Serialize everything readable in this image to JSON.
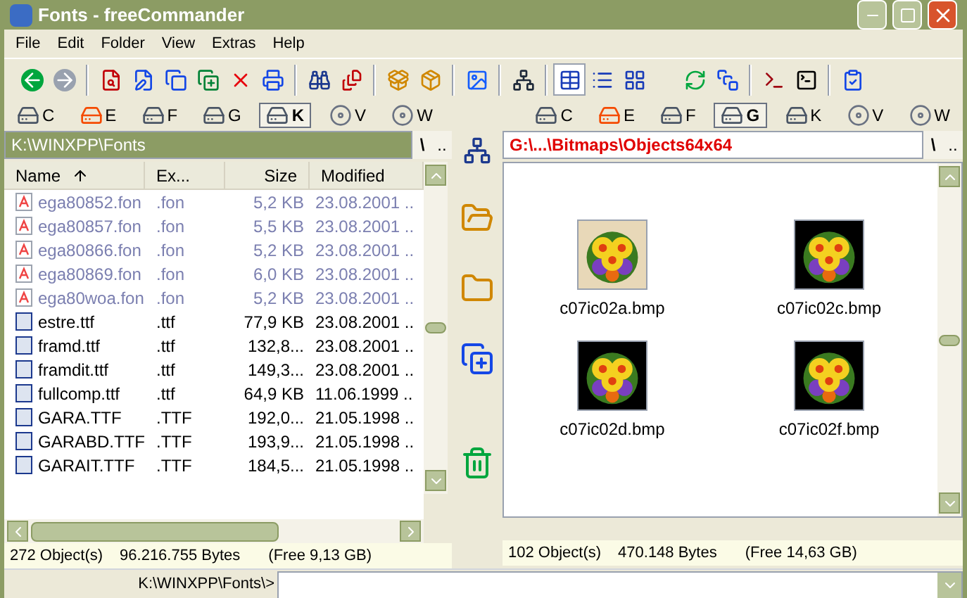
{
  "window": {
    "title": "Fonts - freeCommander"
  },
  "menu": [
    "File",
    "Edit",
    "Folder",
    "View",
    "Extras",
    "Help"
  ],
  "view_modes": [
    {
      "kind": "details",
      "selected": true
    },
    {
      "kind": "list",
      "selected": false
    },
    {
      "kind": "thumbnails",
      "selected": false
    }
  ],
  "left_panel": {
    "drives": [
      {
        "letter": "C",
        "kind": "hdd",
        "selected": false
      },
      {
        "letter": "E",
        "kind": "removable",
        "selected": false
      },
      {
        "letter": "F",
        "kind": "hdd",
        "selected": false
      },
      {
        "letter": "G",
        "kind": "hdd",
        "selected": false
      },
      {
        "letter": "K",
        "kind": "hdd",
        "selected": true
      },
      {
        "letter": "V",
        "kind": "cdrom",
        "selected": false
      },
      {
        "letter": "W",
        "kind": "cdrom",
        "selected": false
      }
    ],
    "path": "K:\\WINXPP\\Fonts",
    "root_button": "\\",
    "up_button": "..",
    "columns": [
      {
        "label": "Name",
        "sorted": true
      },
      {
        "label": "Ex...",
        "sorted": false
      },
      {
        "label": "Size",
        "sorted": false
      },
      {
        "label": "Modified",
        "sorted": false
      }
    ],
    "rows": [
      {
        "kind": "font",
        "dimmed": true,
        "name": "ega80852.fon",
        "ext": ".fon",
        "size": "5,2 KB",
        "modified": "23.08.2001 .."
      },
      {
        "kind": "font",
        "dimmed": true,
        "name": "ega80857.fon",
        "ext": ".fon",
        "size": "5,5 KB",
        "modified": "23.08.2001 .."
      },
      {
        "kind": "font",
        "dimmed": true,
        "name": "ega80866.fon",
        "ext": ".fon",
        "size": "5,2 KB",
        "modified": "23.08.2001 .."
      },
      {
        "kind": "font",
        "dimmed": true,
        "name": "ega80869.fon",
        "ext": ".fon",
        "size": "6,0 KB",
        "modified": "23.08.2001 .."
      },
      {
        "kind": "font",
        "dimmed": true,
        "name": "ega80woa.fon",
        "ext": ".fon",
        "size": "5,2 KB",
        "modified": "23.08.2001 .."
      },
      {
        "kind": "truetype",
        "dimmed": false,
        "name": "estre.ttf",
        "ext": ".ttf",
        "size": "77,9 KB",
        "modified": "23.08.2001 .."
      },
      {
        "kind": "truetype",
        "dimmed": false,
        "name": "framd.ttf",
        "ext": ".ttf",
        "size": "132,8...",
        "modified": "23.08.2001 .."
      },
      {
        "kind": "truetype",
        "dimmed": false,
        "name": "framdit.ttf",
        "ext": ".ttf",
        "size": "149,3...",
        "modified": "23.08.2001 .."
      },
      {
        "kind": "truetype",
        "dimmed": false,
        "name": "fullcomp.ttf",
        "ext": ".ttf",
        "size": "64,9 KB",
        "modified": "11.06.1999 .."
      },
      {
        "kind": "truetype",
        "dimmed": false,
        "name": "GARA.TTF",
        "ext": ".TTF",
        "size": "192,0...",
        "modified": "21.05.1998 .."
      },
      {
        "kind": "truetype",
        "dimmed": false,
        "name": "GARABD.TTF",
        "ext": ".TTF",
        "size": "193,9...",
        "modified": "21.05.1998 .."
      },
      {
        "kind": "truetype",
        "dimmed": false,
        "name": "GARAIT.TTF",
        "ext": ".TTF",
        "size": "184,5...",
        "modified": "21.05.1998 .."
      }
    ],
    "status": {
      "objects": "272 Object(s)",
      "bytes": "96.216.755 Bytes",
      "free": "(Free 9,13 GB)"
    }
  },
  "right_panel": {
    "drives": [
      {
        "letter": "C",
        "kind": "hdd",
        "selected": false
      },
      {
        "letter": "E",
        "kind": "removable",
        "selected": false
      },
      {
        "letter": "F",
        "kind": "hdd",
        "selected": false
      },
      {
        "letter": "G",
        "kind": "hdd",
        "selected": true
      },
      {
        "letter": "K",
        "kind": "hdd",
        "selected": false
      },
      {
        "letter": "V",
        "kind": "cdrom",
        "selected": false
      },
      {
        "letter": "W",
        "kind": "cdrom",
        "selected": false
      }
    ],
    "path": "G:\\...\\Bitmaps\\Objects64x64",
    "root_button": "\\",
    "up_button": "..",
    "thumbnails": [
      {
        "name": "c07ic02a.bmp",
        "kind": "picture"
      },
      {
        "name": "c07ic02c.bmp",
        "kind": "picture"
      },
      {
        "name": "c07ic02d.bmp",
        "kind": "picture"
      },
      {
        "name": "c07ic02f.bmp",
        "kind": "picture"
      }
    ],
    "status": {
      "objects": "102 Object(s)",
      "bytes": "470.148 Bytes",
      "free": "(Free 14,63 GB)"
    }
  },
  "command_line": {
    "prompt": "K:\\WINXPP\\Fonts\\>"
  }
}
